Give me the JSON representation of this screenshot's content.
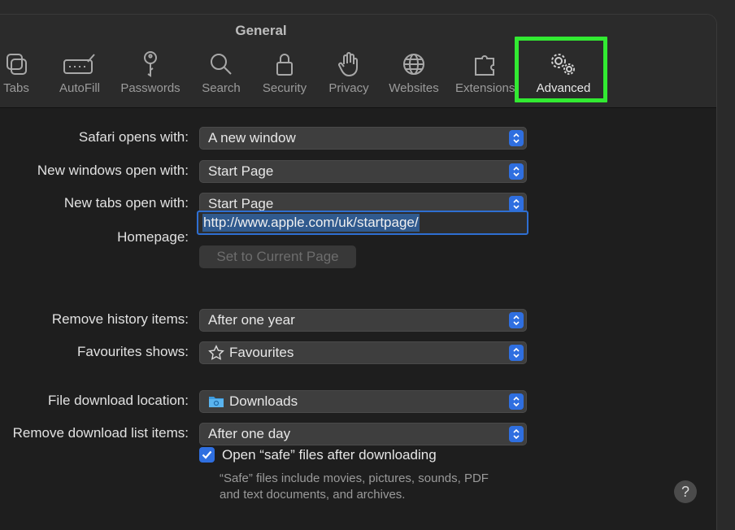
{
  "window": {
    "title": "General"
  },
  "tabs": [
    {
      "label": "Tabs",
      "icon": "tabs-icon"
    },
    {
      "label": "AutoFill",
      "icon": "autofill-icon"
    },
    {
      "label": "Passwords",
      "icon": "key-icon"
    },
    {
      "label": "Search",
      "icon": "search-icon"
    },
    {
      "label": "Security",
      "icon": "lock-icon"
    },
    {
      "label": "Privacy",
      "icon": "hand-icon"
    },
    {
      "label": "Websites",
      "icon": "globe-icon"
    },
    {
      "label": "Extensions",
      "icon": "puzzle-icon"
    },
    {
      "label": "Advanced",
      "icon": "gears-icon"
    }
  ],
  "highlight_color": "#32ea32",
  "accent_color": "#2f6fe0",
  "settings": {
    "safari_opens": {
      "label": "Safari opens with:",
      "value": "A new window"
    },
    "new_windows": {
      "label": "New windows open with:",
      "value": "Start Page"
    },
    "new_tabs": {
      "label": "New tabs open with:",
      "value": "Start Page"
    },
    "homepage": {
      "label": "Homepage:",
      "value": "http://www.apple.com/uk/startpage/"
    },
    "set_current_page": "Set to Current Page",
    "remove_history": {
      "label": "Remove history items:",
      "value": "After one year"
    },
    "favourites_shows": {
      "label": "Favourites shows:",
      "value": "Favourites",
      "icon": "star-icon"
    },
    "download_location": {
      "label": "File download location:",
      "value": "Downloads",
      "icon": "folder-icon"
    },
    "remove_download": {
      "label": "Remove download list items:",
      "value": "After one day"
    },
    "open_safe_files": {
      "label": "Open “safe” files after downloading",
      "checked": true
    },
    "safe_note": "“Safe” files include movies, pictures, sounds, PDF and text documents, and archives."
  },
  "help": "?"
}
